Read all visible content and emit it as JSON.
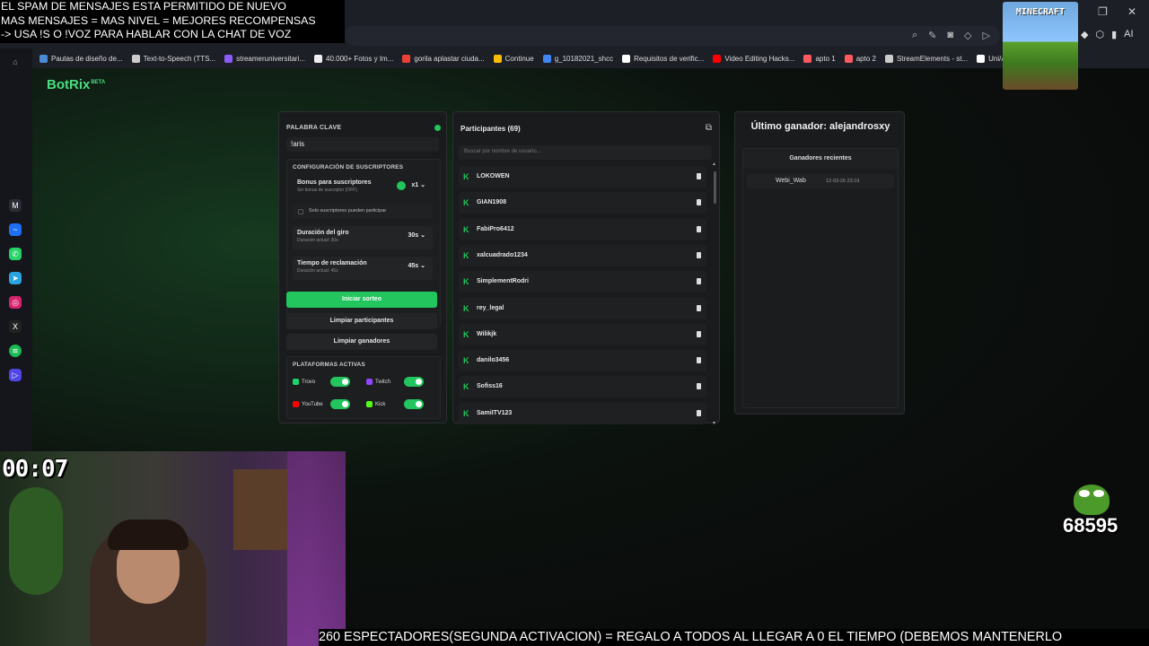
{
  "browser": {
    "bookmarks": [
      {
        "label": "Pautas de diseño de...",
        "color": "#4b8bd6"
      },
      {
        "label": "Text-to-Speech (TTS...",
        "color": "#cccccc"
      },
      {
        "label": "streameruniversitari...",
        "color": "#8b5cf6"
      },
      {
        "label": "40.000+ Fotos y Im...",
        "color": "#eeeeee"
      },
      {
        "label": "gorila aplastar ciuda...",
        "color": "#ea4335"
      },
      {
        "label": "Continue",
        "color": "#fbbc05"
      },
      {
        "label": "g_10182021_shcc",
        "color": "#4285f4"
      },
      {
        "label": "Requisitos de verific...",
        "color": "#ffffff"
      },
      {
        "label": "Video Editing Hacks...",
        "color": "#ff0000"
      },
      {
        "label": "apto 1",
        "color": "#ff5a5f"
      },
      {
        "label": "apto 2",
        "color": "#ff5a5f"
      },
      {
        "label": "StreamElements - st...",
        "color": "#cccccc"
      },
      {
        "label": "Uni/Aris",
        "color": "#ffffff"
      }
    ],
    "ai_label": "AI"
  },
  "app": {
    "brand": "BotRix",
    "brand_badge": "BETA",
    "accent": "#22c55e"
  },
  "left": {
    "keyword_label": "PALABRA CLAVE",
    "keyword_value": "!aris",
    "sub_config_label": "CONFIGURACIÓN DE SUSCRIPTORES",
    "bonus_title": "Bonus para suscriptores",
    "bonus_sub": "Sin bonus de suscriptor (OFF)",
    "bonus_value": "x1",
    "only_subs": "Solo suscriptores pueden participar",
    "spin_title": "Duración del giro",
    "spin_sub": "Duración actual: 30s",
    "spin_value": "30s",
    "claim_title": "Tiempo de reclamación",
    "claim_sub": "Duración actual: 45s",
    "claim_value": "45s",
    "start_btn": "Iniciar sorteo",
    "clear_participants": "Limpiar participantes",
    "clear_winners": "Limpiar ganadores",
    "platforms_label": "PLATAFORMAS ACTIVAS",
    "platforms": [
      {
        "name": "Trovo",
        "color": "#19d66b"
      },
      {
        "name": "Twitch",
        "color": "#9146ff"
      },
      {
        "name": "YouTube",
        "color": "#ff0000"
      },
      {
        "name": "Kick",
        "color": "#53fc18"
      }
    ]
  },
  "participants": {
    "title": "Participantes (69)",
    "search_placeholder": "Buscar por nombre de usuario...",
    "list": [
      "LOKOWEN",
      "GIAN1908",
      "FabiPro6412",
      "xalcuadrado1234",
      "SimplementRodri",
      "rey_legal",
      "Wilikjk",
      "danilo3456",
      "Sofiss16",
      "SamiITV123"
    ]
  },
  "winner": {
    "title": "Último ganador: alejandrosxy",
    "recent_label": "Ganadores recientes",
    "recent": [
      {
        "name": "Webi_Wab",
        "date": "12-03-26 23:19"
      }
    ]
  },
  "overlay": {
    "banner_lines": [
      "EL SPAM DE MENSAJES ESTA PERMITIDO DE NUEVO",
      "MAS MENSAJES = MAS NIVEL = MEJORES RECOMPENSAS",
      "-> USA !S O !VOZ PARA HABLAR CON LA CHAT DE VOZ"
    ],
    "minecraft": "MINECRAFT",
    "timer": "00:07",
    "counter": "68595",
    "ticker": "260 ESPECTADORES(SEGUNDA ACTIVACION) = REGALO A TODOS AL LLEGAR A 0 EL TIEMPO (DEBEMOS MANTENERLO"
  }
}
